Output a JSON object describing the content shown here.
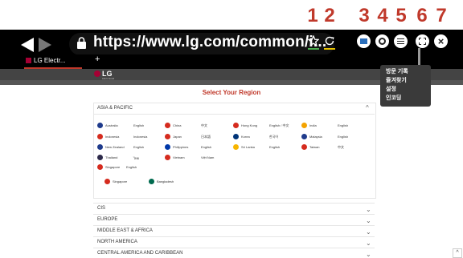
{
  "browser": {
    "url": "https://www.lg.com/common/i...",
    "tab_label": "LG Electr...",
    "new_tab": "+",
    "callouts": [
      "1",
      "2",
      "3",
      "4",
      "5",
      "6",
      "7"
    ],
    "tooltip_items": [
      "방문 기록",
      "즐겨찾기",
      "설정",
      "인코딩"
    ]
  },
  "page": {
    "logo_text": "LG",
    "logo_sub": "Life's Good",
    "title": "Select Your Region",
    "asia_header": "ASIA & PACIFIC",
    "countries": [
      {
        "name": "Australia",
        "lang": "English",
        "color": "#1f3b8c"
      },
      {
        "name": "China",
        "lang": "中文",
        "color": "#d52b1e"
      },
      {
        "name": "Hong Kong",
        "lang": "English / 中文",
        "color": "#d52b1e"
      },
      {
        "name": "India",
        "lang": "English",
        "color": "#f4a300"
      },
      {
        "name": "Indonesia",
        "lang": "Indonesia",
        "color": "#d52b1e"
      },
      {
        "name": "Japan",
        "lang": "日本語",
        "color": "#d52b1e"
      },
      {
        "name": "Korea",
        "lang": "한국어",
        "color": "#003478"
      },
      {
        "name": "Malaysia",
        "lang": "English",
        "color": "#1f3b8c"
      },
      {
        "name": "New Zealand",
        "lang": "English",
        "color": "#1f3b8c"
      },
      {
        "name": "Philippines",
        "lang": "English",
        "color": "#0038a8"
      },
      {
        "name": "Sri Lanka",
        "lang": "English",
        "color": "#f7b500"
      },
      {
        "name": "Taiwan",
        "lang": "中文",
        "color": "#d52b1e"
      },
      {
        "name": "Thailand",
        "lang": "ไทย",
        "color": "#2d2a4a"
      },
      {
        "name": "Vietnam",
        "lang": "Việt Nam",
        "color": "#d52b1e"
      },
      {
        "name": "Singapore",
        "lang": "English",
        "color": "#d52b1e"
      },
      {
        "name": "Singapore",
        "lang": "",
        "color": "#d52b1e"
      },
      {
        "name": "Bangladesh",
        "lang": "",
        "color": "#006a4e"
      }
    ],
    "regions": [
      "CIS",
      "EUROPE",
      "MIDDLE EAST & AFRICA",
      "NORTH AMERICA",
      "CENTRAL AMERICA AND CARIBBEAN"
    ],
    "scroll_top": "^"
  }
}
